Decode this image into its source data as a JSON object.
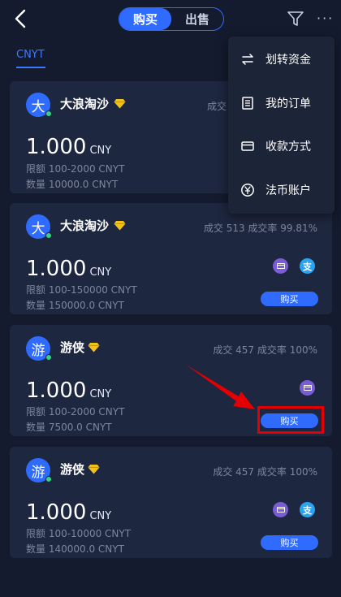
{
  "header": {
    "tabs": [
      {
        "label": "购买",
        "active": true
      },
      {
        "label": "出售",
        "active": false
      }
    ],
    "more_label": "···"
  },
  "coin_tab": "CNYT",
  "dropdown": {
    "items": [
      {
        "label": "划转资金",
        "icon": "transfer-icon"
      },
      {
        "label": "我的订单",
        "icon": "orders-icon"
      },
      {
        "label": "收款方式",
        "icon": "payment-method-icon"
      },
      {
        "label": "法币账户",
        "icon": "fiat-account-icon"
      }
    ]
  },
  "offers": [
    {
      "avatar": "大",
      "name": "大浪淘沙",
      "stats": "成交",
      "price": "1.000",
      "unit": "CNY",
      "limit": "限额   100-2000 CNYT",
      "qty": "数量   10000.0 CNYT",
      "payments": [],
      "buy_label": ""
    },
    {
      "avatar": "大",
      "name": "大浪淘沙",
      "stats": "成交 513   成交率 99.81%",
      "price": "1.000",
      "unit": "CNY",
      "limit": "限额   100-150000 CNYT",
      "qty": "数量   150000.0 CNYT",
      "payments": [
        "card",
        "alipay"
      ],
      "buy_label": "购买"
    },
    {
      "avatar": "游",
      "name": "游侠",
      "stats": "成交 457   成交率 100%",
      "price": "1.000",
      "unit": "CNY",
      "limit": "限额   100-2000 CNYT",
      "qty": "数量   7500.0 CNYT",
      "payments": [
        "card"
      ],
      "buy_label": "购买"
    },
    {
      "avatar": "游",
      "name": "游侠",
      "stats": "成交 457   成交率 100%",
      "price": "1.000",
      "unit": "CNY",
      "limit": "限额   100-10000 CNYT",
      "qty": "数量   140000.0 CNYT",
      "payments": [
        "card",
        "alipay"
      ],
      "buy_label": "购买"
    }
  ],
  "alipay_glyph": "支",
  "colors": {
    "background": "#141b2e",
    "card": "#1e2740",
    "accent": "#2f6bff",
    "highlight": "#e40000",
    "diamond": "#f2c21b"
  }
}
